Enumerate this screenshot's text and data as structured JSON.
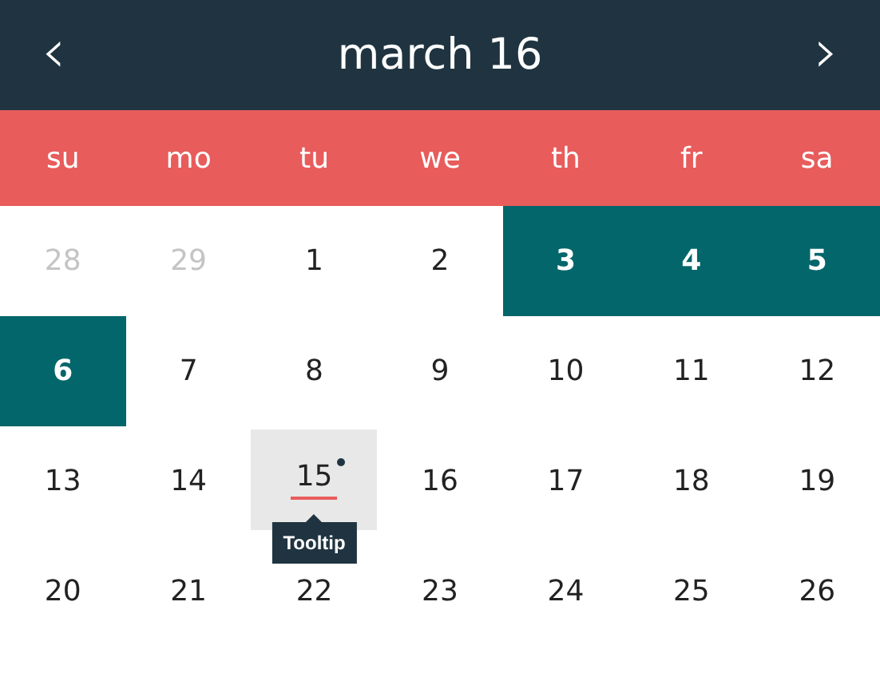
{
  "header": {
    "prev": "‹",
    "title": "march 16",
    "next": "›"
  },
  "weekdays": [
    "su",
    "mo",
    "tu",
    "we",
    "th",
    "fr",
    "sa"
  ],
  "days": [
    {
      "label": "28",
      "muted": true,
      "selected": false,
      "today": false,
      "event": false
    },
    {
      "label": "29",
      "muted": true,
      "selected": false,
      "today": false,
      "event": false
    },
    {
      "label": "1",
      "muted": false,
      "selected": false,
      "today": false,
      "event": false
    },
    {
      "label": "2",
      "muted": false,
      "selected": false,
      "today": false,
      "event": false
    },
    {
      "label": "3",
      "muted": false,
      "selected": true,
      "today": false,
      "event": false
    },
    {
      "label": "4",
      "muted": false,
      "selected": true,
      "today": false,
      "event": false
    },
    {
      "label": "5",
      "muted": false,
      "selected": true,
      "today": false,
      "event": false
    },
    {
      "label": "6",
      "muted": false,
      "selected": true,
      "today": false,
      "event": false
    },
    {
      "label": "7",
      "muted": false,
      "selected": false,
      "today": false,
      "event": false
    },
    {
      "label": "8",
      "muted": false,
      "selected": false,
      "today": false,
      "event": false
    },
    {
      "label": "9",
      "muted": false,
      "selected": false,
      "today": false,
      "event": false
    },
    {
      "label": "10",
      "muted": false,
      "selected": false,
      "today": false,
      "event": false
    },
    {
      "label": "11",
      "muted": false,
      "selected": false,
      "today": false,
      "event": false
    },
    {
      "label": "12",
      "muted": false,
      "selected": false,
      "today": false,
      "event": false
    },
    {
      "label": "13",
      "muted": false,
      "selected": false,
      "today": false,
      "event": false
    },
    {
      "label": "14",
      "muted": false,
      "selected": false,
      "today": false,
      "event": false
    },
    {
      "label": "15",
      "muted": false,
      "selected": false,
      "today": true,
      "event": true,
      "tooltip": "Tooltip"
    },
    {
      "label": "16",
      "muted": false,
      "selected": false,
      "today": false,
      "event": false
    },
    {
      "label": "17",
      "muted": false,
      "selected": false,
      "today": false,
      "event": false
    },
    {
      "label": "18",
      "muted": false,
      "selected": false,
      "today": false,
      "event": false
    },
    {
      "label": "19",
      "muted": false,
      "selected": false,
      "today": false,
      "event": false
    },
    {
      "label": "20",
      "muted": false,
      "selected": false,
      "today": false,
      "event": false
    },
    {
      "label": "21",
      "muted": false,
      "selected": false,
      "today": false,
      "event": false
    },
    {
      "label": "22",
      "muted": false,
      "selected": false,
      "today": false,
      "event": false
    },
    {
      "label": "23",
      "muted": false,
      "selected": false,
      "today": false,
      "event": false
    },
    {
      "label": "24",
      "muted": false,
      "selected": false,
      "today": false,
      "event": false
    },
    {
      "label": "25",
      "muted": false,
      "selected": false,
      "today": false,
      "event": false
    },
    {
      "label": "26",
      "muted": false,
      "selected": false,
      "today": false,
      "event": false
    }
  ]
}
